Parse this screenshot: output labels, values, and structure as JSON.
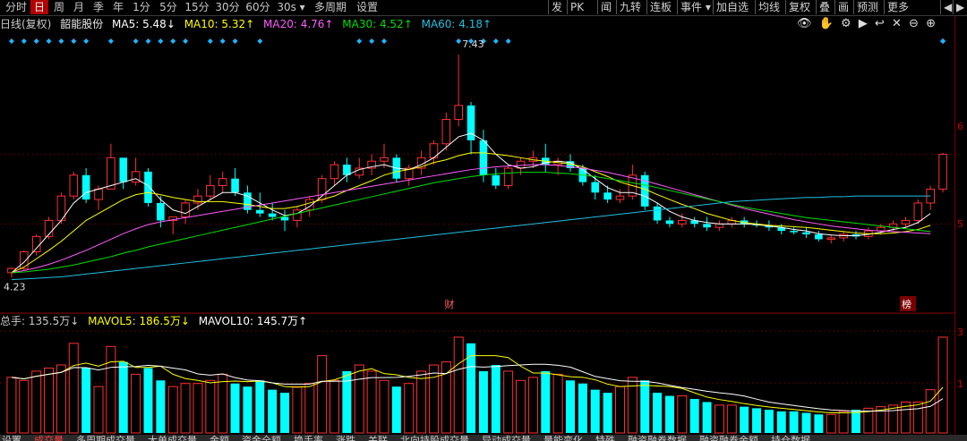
{
  "top_tabs": [
    "分时",
    "日",
    "周",
    "月",
    "季",
    "年",
    "1分",
    "5分",
    "15分",
    "30分",
    "60分",
    "30s",
    "多周期",
    "设置"
  ],
  "active_tab": "日",
  "period_dropdown": "30s",
  "toolbar": {
    "items": [
      "发",
      "PK",
      "闻",
      "九转",
      "连板",
      "事件",
      "加自选",
      "均线",
      "复权",
      "叠",
      "画",
      "预测",
      "更多"
    ],
    "event_arrow": "▾"
  },
  "legend": {
    "label": "日线(复权)",
    "stock": "韶能股份",
    "ma5": "MA5: 5.48↓",
    "ma10": "MA10: 5.32↑",
    "ma20": "MA20: 4.76↑",
    "ma30": "MA30: 4.52↑",
    "ma60": "MA60: 4.18↑"
  },
  "price_annotations": {
    "high": "7.43",
    "low": "4.23",
    "event1": "财",
    "event2": "榜"
  },
  "right_axis_ticks": [
    "6",
    "5",
    "3",
    "1"
  ],
  "volume_legend": {
    "total": "总手: 135.5万↓",
    "mavol5": "MAVOL5: 186.5万↓",
    "mavol10": "MAVOL10: 145.7万↑"
  },
  "bottom_tabs": [
    "设置",
    "成交量",
    "多周期成交量",
    "大单成交量",
    "金额",
    "资金全额",
    "换手率",
    "涨跌",
    "关联",
    "北向持股成交量",
    "异动成交量",
    "量能变化",
    "特殊",
    "融资融券数据",
    "融资融券余额",
    "持仓数据"
  ],
  "colors": {
    "up": "#ff3030",
    "down": "#00ffff",
    "ma5": "#ffffff",
    "ma10": "#ffff00",
    "ma20": "#ff5cff",
    "ma30": "#00e000",
    "ma60": "#20c0e0"
  },
  "chart_data": {
    "type": "candlestick",
    "candles": [
      [
        4.3,
        4.38,
        4.23,
        4.36
      ],
      [
        4.36,
        4.62,
        4.33,
        4.6
      ],
      [
        4.6,
        4.85,
        4.55,
        4.82
      ],
      [
        4.82,
        5.1,
        4.78,
        5.05
      ],
      [
        5.05,
        5.45,
        5.0,
        5.4
      ],
      [
        5.4,
        5.75,
        5.35,
        5.7
      ],
      [
        5.7,
        5.8,
        5.3,
        5.35
      ],
      [
        5.35,
        5.55,
        5.2,
        5.5
      ],
      [
        5.5,
        6.15,
        5.5,
        5.95
      ],
      [
        5.95,
        5.6,
        5.5,
        5.6
      ],
      [
        5.6,
        5.95,
        5.55,
        5.75
      ],
      [
        5.75,
        5.8,
        5.25,
        5.3
      ],
      [
        5.3,
        5.4,
        4.95,
        5.05
      ],
      [
        5.05,
        5.1,
        4.85,
        5.1
      ],
      [
        5.1,
        5.35,
        5.0,
        5.3
      ],
      [
        5.3,
        5.5,
        5.2,
        5.4
      ],
      [
        5.4,
        5.7,
        5.35,
        5.55
      ],
      [
        5.55,
        5.75,
        5.45,
        5.65
      ],
      [
        5.65,
        5.8,
        5.4,
        5.45
      ],
      [
        5.45,
        5.55,
        5.15,
        5.2
      ],
      [
        5.2,
        5.45,
        5.1,
        5.15
      ],
      [
        5.15,
        5.3,
        5.05,
        5.1
      ],
      [
        5.1,
        5.2,
        4.9,
        5.05
      ],
      [
        5.05,
        5.25,
        4.95,
        5.2
      ],
      [
        5.2,
        5.4,
        5.1,
        5.35
      ],
      [
        5.35,
        5.7,
        5.3,
        5.65
      ],
      [
        5.65,
        5.9,
        5.55,
        5.85
      ],
      [
        5.85,
        5.95,
        5.6,
        5.7
      ],
      [
        5.7,
        5.95,
        5.65,
        5.8
      ],
      [
        5.8,
        6.0,
        5.7,
        5.9
      ],
      [
        5.9,
        6.15,
        5.8,
        5.95
      ],
      [
        5.95,
        6.0,
        5.6,
        5.65
      ],
      [
        5.65,
        5.85,
        5.55,
        5.8
      ],
      [
        5.8,
        6.05,
        5.7,
        5.95
      ],
      [
        5.95,
        6.2,
        5.85,
        6.15
      ],
      [
        6.15,
        6.6,
        6.05,
        6.5
      ],
      [
        6.5,
        7.43,
        6.4,
        6.7
      ],
      [
        6.7,
        6.75,
        6.0,
        6.2
      ],
      [
        6.2,
        6.35,
        5.6,
        5.7
      ],
      [
        5.7,
        5.8,
        5.5,
        5.55
      ],
      [
        5.55,
        5.85,
        5.5,
        5.8
      ],
      [
        5.8,
        5.95,
        5.7,
        5.9
      ],
      [
        5.9,
        6.05,
        5.8,
        5.95
      ],
      [
        5.95,
        6.15,
        5.75,
        5.85
      ],
      [
        5.85,
        5.95,
        5.7,
        5.9
      ],
      [
        5.9,
        6.0,
        5.75,
        5.8
      ],
      [
        5.8,
        5.85,
        5.55,
        5.6
      ],
      [
        5.6,
        5.7,
        5.35,
        5.45
      ],
      [
        5.45,
        5.55,
        5.3,
        5.35
      ],
      [
        5.35,
        5.5,
        5.3,
        5.4
      ],
      [
        5.4,
        5.85,
        5.35,
        5.7
      ],
      [
        5.7,
        5.75,
        5.2,
        5.25
      ],
      [
        5.25,
        5.3,
        5.0,
        5.05
      ],
      [
        5.05,
        5.1,
        4.95,
        5.0
      ],
      [
        5.0,
        5.15,
        4.95,
        5.05
      ],
      [
        5.05,
        5.1,
        4.95,
        5.0
      ],
      [
        5.0,
        5.1,
        4.9,
        4.95
      ],
      [
        4.95,
        5.05,
        4.9,
        5.0
      ],
      [
        5.0,
        5.1,
        4.95,
        5.05
      ],
      [
        5.05,
        5.1,
        4.95,
        5.0
      ],
      [
        5.0,
        5.05,
        4.95,
        4.98
      ],
      [
        4.98,
        5.05,
        4.9,
        4.95
      ],
      [
        4.95,
        5.0,
        4.85,
        4.9
      ],
      [
        4.9,
        4.95,
        4.85,
        4.88
      ],
      [
        4.88,
        4.95,
        4.8,
        4.85
      ],
      [
        4.85,
        4.9,
        4.75,
        4.78
      ],
      [
        4.78,
        4.85,
        4.72,
        4.8
      ],
      [
        4.8,
        4.9,
        4.75,
        4.85
      ],
      [
        4.85,
        4.9,
        4.78,
        4.82
      ],
      [
        4.82,
        4.95,
        4.78,
        4.9
      ],
      [
        4.9,
        5.0,
        4.85,
        4.95
      ],
      [
        4.95,
        5.05,
        4.88,
        5.0
      ],
      [
        5.0,
        5.1,
        4.95,
        5.05
      ],
      [
        5.05,
        5.35,
        5.0,
        5.3
      ],
      [
        5.3,
        5.55,
        5.2,
        5.5
      ],
      [
        5.5,
        6.02,
        5.45,
        6.0
      ]
    ],
    "ma_lines": {
      "MA5": [
        4.3,
        4.45,
        4.65,
        4.85,
        5.05,
        5.3,
        5.45,
        5.5,
        5.55,
        5.6,
        5.65,
        5.55,
        5.35,
        5.2,
        5.15,
        5.25,
        5.35,
        5.45,
        5.45,
        5.4,
        5.3,
        5.2,
        5.12,
        5.15,
        5.25,
        5.4,
        5.55,
        5.7,
        5.78,
        5.82,
        5.85,
        5.8,
        5.78,
        5.85,
        5.95,
        6.1,
        6.25,
        6.3,
        6.2,
        6.0,
        5.85,
        5.8,
        5.82,
        5.88,
        5.9,
        5.88,
        5.78,
        5.65,
        5.52,
        5.45,
        5.45,
        5.4,
        5.3,
        5.18,
        5.1,
        5.05,
        5.02,
        5.0,
        5.0,
        5.0,
        4.99,
        4.97,
        4.95,
        4.92,
        4.9,
        4.86,
        4.84,
        4.83,
        4.83,
        4.85,
        4.88,
        4.92,
        4.95,
        5.02,
        5.15,
        5.48
      ],
      "MA10": [
        4.3,
        4.38,
        4.5,
        4.62,
        4.75,
        4.9,
        5.05,
        5.15,
        5.25,
        5.35,
        5.42,
        5.45,
        5.42,
        5.38,
        5.35,
        5.32,
        5.32,
        5.32,
        5.3,
        5.28,
        5.25,
        5.22,
        5.22,
        5.25,
        5.3,
        5.35,
        5.4,
        5.48,
        5.55,
        5.62,
        5.7,
        5.75,
        5.78,
        5.82,
        5.88,
        5.92,
        5.98,
        6.02,
        6.02,
        6.0,
        5.98,
        5.95,
        5.92,
        5.9,
        5.88,
        5.86,
        5.82,
        5.75,
        5.68,
        5.6,
        5.55,
        5.5,
        5.42,
        5.35,
        5.28,
        5.22,
        5.15,
        5.1,
        5.05,
        5.02,
        5.0,
        4.98,
        4.97,
        4.96,
        4.95,
        4.93,
        4.91,
        4.89,
        4.87,
        4.86,
        4.86,
        4.87,
        4.89,
        4.92,
        4.98,
        5.32
      ],
      "MA20": [
        4.3,
        4.33,
        4.37,
        4.42,
        4.48,
        4.55,
        4.62,
        4.7,
        4.78,
        4.86,
        4.93,
        4.99,
        5.03,
        5.06,
        5.09,
        5.12,
        5.15,
        5.18,
        5.21,
        5.24,
        5.27,
        5.3,
        5.33,
        5.36,
        5.39,
        5.42,
        5.45,
        5.48,
        5.51,
        5.54,
        5.57,
        5.6,
        5.63,
        5.66,
        5.69,
        5.72,
        5.75,
        5.78,
        5.8,
        5.82,
        5.83,
        5.84,
        5.85,
        5.85,
        5.84,
        5.82,
        5.8,
        5.77,
        5.74,
        5.7,
        5.66,
        5.62,
        5.57,
        5.52,
        5.47,
        5.42,
        5.37,
        5.32,
        5.27,
        5.22,
        5.18,
        5.14,
        5.1,
        5.06,
        5.03,
        5.0,
        4.97,
        4.95,
        4.93,
        4.91,
        4.9,
        4.89,
        4.88,
        4.87,
        4.86,
        4.76
      ],
      "MA30": [
        4.3,
        4.31,
        4.33,
        4.35,
        4.38,
        4.41,
        4.45,
        4.49,
        4.53,
        4.58,
        4.62,
        4.67,
        4.71,
        4.75,
        4.79,
        4.83,
        4.87,
        4.91,
        4.95,
        4.99,
        5.03,
        5.07,
        5.11,
        5.15,
        5.19,
        5.23,
        5.27,
        5.31,
        5.35,
        5.39,
        5.43,
        5.47,
        5.51,
        5.55,
        5.59,
        5.62,
        5.65,
        5.68,
        5.7,
        5.72,
        5.73,
        5.74,
        5.74,
        5.74,
        5.73,
        5.72,
        5.7,
        5.68,
        5.65,
        5.62,
        5.59,
        5.56,
        5.52,
        5.48,
        5.44,
        5.4,
        5.36,
        5.32,
        5.28,
        5.24,
        5.21,
        5.18,
        5.15,
        5.12,
        5.09,
        5.07,
        5.05,
        5.03,
        5.01,
        4.99,
        4.97,
        4.95,
        4.93,
        4.91,
        4.89,
        4.52
      ],
      "MA60": [
        4.2,
        4.21,
        4.22,
        4.23,
        4.24,
        4.26,
        4.28,
        4.3,
        4.32,
        4.34,
        4.36,
        4.38,
        4.4,
        4.42,
        4.44,
        4.46,
        4.48,
        4.5,
        4.52,
        4.54,
        4.56,
        4.58,
        4.6,
        4.62,
        4.64,
        4.66,
        4.68,
        4.7,
        4.72,
        4.74,
        4.76,
        4.78,
        4.8,
        4.82,
        4.84,
        4.86,
        4.88,
        4.9,
        4.92,
        4.94,
        4.96,
        4.98,
        5.0,
        5.02,
        5.04,
        5.06,
        5.08,
        5.1,
        5.12,
        5.14,
        5.16,
        5.18,
        5.2,
        5.22,
        5.24,
        5.26,
        5.28,
        5.3,
        5.32,
        5.33,
        5.34,
        5.35,
        5.36,
        5.37,
        5.38,
        5.38,
        5.39,
        5.39,
        5.4,
        5.4,
        5.4,
        5.4,
        5.4,
        5.4,
        5.4,
        4.18
      ]
    },
    "volumes": [
      180,
      170,
      200,
      210,
      220,
      290,
      210,
      150,
      280,
      230,
      190,
      210,
      170,
      150,
      160,
      160,
      170,
      190,
      160,
      150,
      170,
      140,
      130,
      150,
      160,
      250,
      170,
      200,
      220,
      200,
      170,
      150,
      160,
      200,
      220,
      230,
      310,
      290,
      200,
      220,
      200,
      170,
      180,
      200,
      190,
      170,
      160,
      140,
      130,
      150,
      180,
      170,
      130,
      120,
      120,
      110,
      100,
      90,
      90,
      85,
      80,
      75,
      70,
      70,
      65,
      60,
      60,
      70,
      75,
      80,
      85,
      90,
      100,
      100,
      140,
      310
    ],
    "ylim": [
      3.9,
      7.7
    ],
    "vol_max": 330
  }
}
